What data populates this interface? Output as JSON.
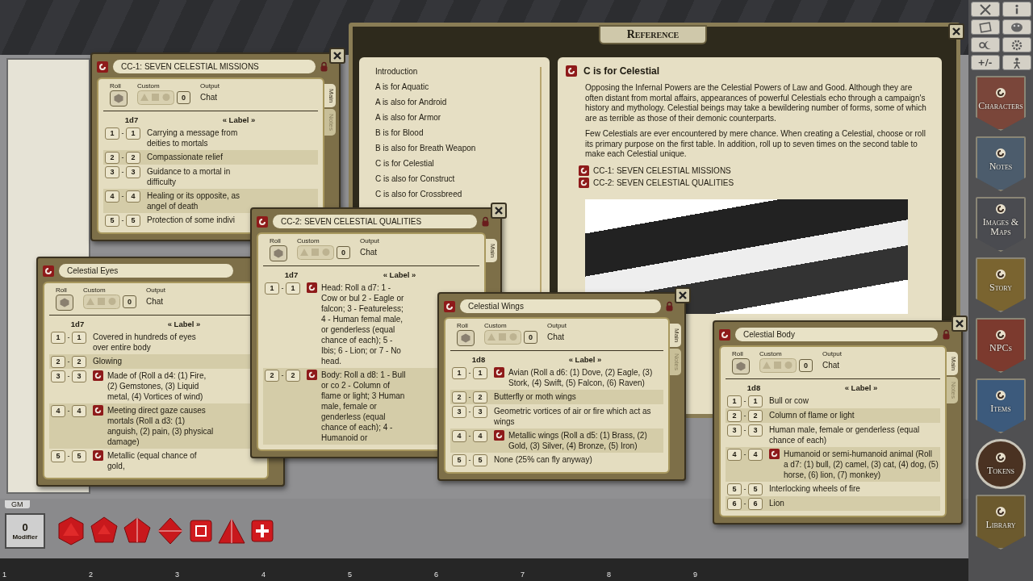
{
  "reference": {
    "title": "Reference",
    "index": [
      "Introduction",
      "A is for Aquatic",
      "A is also for Android",
      "A is also for Armor",
      "B is for Blood",
      "B is also for Breath Weapon",
      "C is for Celestial",
      "C is also for Construct",
      "C is also for Crossbreed"
    ],
    "heading": "C is for Celestial",
    "paragraphs": [
      "Opposing the Infernal Powers are the Celestial Powers of Law and Good. Although they are often distant from mortal affairs, appearances of powerful Celestials echo through a campaign's history and mythology. Celestial beings may take a bewildering number of forms, some of which are as terrible as those of their demonic counterparts.",
      "Few Celestials are ever encountered by mere chance. When creating a Celestial, choose or roll its primary purpose on the first table. In addition, roll up to seven times on the second table to make each Celestial unique."
    ],
    "links": [
      "CC-1: SEVEN CELESTIAL MISSIONS",
      "CC-2: SEVEN CELESTIAL QUALITIES"
    ]
  },
  "tables": [
    {
      "title": "CC-1: SEVEN CELESTIAL MISSIONS",
      "locked": true,
      "roll_label": "Roll",
      "custom_label": "Custom",
      "output_label": "Output",
      "custom_value": "0",
      "output": "Chat",
      "dice": "1d7",
      "label_header": "« Label »",
      "tabs": [
        {
          "label": "Main",
          "selected": true
        },
        {
          "label": "Notes",
          "selected": false
        }
      ],
      "rows": [
        {
          "from": "1",
          "dash": "-",
          "to": "1",
          "text": "Carrying a message from deities to mortals",
          "linked": false
        },
        {
          "from": "2",
          "dash": "-",
          "to": "2",
          "text": "Compassionate relief",
          "linked": false
        },
        {
          "from": "3",
          "dash": "-",
          "to": "3",
          "text": "Guidance to a mortal in difficulty",
          "linked": false
        },
        {
          "from": "4",
          "dash": "-",
          "to": "4",
          "text": "Healing or its opposite, as angel of death",
          "linked": false
        },
        {
          "from": "5",
          "dash": "-",
          "to": "5",
          "text": "Protection of some indivi",
          "linked": false
        }
      ]
    },
    {
      "title": "Celestial Eyes",
      "roll_label": "Roll",
      "custom_label": "Custom",
      "output_label": "Output",
      "custom_value": "0",
      "output": "Chat",
      "dice": "1d7",
      "label_header": "« Label »",
      "rows": [
        {
          "from": "1",
          "dash": "-",
          "to": "1",
          "text": "Covered in hundreds of eyes over entire body",
          "linked": false
        },
        {
          "from": "2",
          "dash": "-",
          "to": "2",
          "text": "Glowing",
          "linked": false
        },
        {
          "from": "3",
          "dash": "-",
          "to": "3",
          "text": "Made of (Roll a d4: (1) Fire, (2) Gemstones, (3) Liquid metal, (4) Vortices of wind)",
          "linked": true
        },
        {
          "from": "4",
          "dash": "-",
          "to": "4",
          "text": "Meeting direct gaze causes mortals (Roll a d3: (1) anguish, (2) pain, (3) physical damage)",
          "linked": true
        },
        {
          "from": "5",
          "dash": "-",
          "to": "5",
          "text": "Metallic (equal chance of gold,",
          "linked": true
        }
      ]
    },
    {
      "title": "CC-2: SEVEN CELESTIAL QUALITIES",
      "locked": true,
      "roll_label": "Roll",
      "custom_label": "Custom",
      "output_label": "Output",
      "custom_value": "0",
      "output": "Chat",
      "dice": "1d7",
      "label_header": "« Label »",
      "tabs": [
        {
          "label": "Main",
          "selected": true
        }
      ],
      "rows": [
        {
          "from": "1",
          "dash": "-",
          "to": "1",
          "text": "Head: Roll a d7: 1 - Cow or bul 2 - Eagle or falcon; 3 - Featureless; 4 - Human femal male, or genderless (equal chance of each); 5 - Ibis; 6 - Lion; or 7 - No head.",
          "linked": true
        },
        {
          "from": "2",
          "dash": "-",
          "to": "2",
          "text": "Body: Roll a d8: 1 - Bull or co 2 - Column of flame or light; 3 Human male, female or genderless (equal chance of each); 4 - Humanoid or",
          "linked": true
        }
      ]
    },
    {
      "title": "Celestial Wings",
      "locked": true,
      "roll_label": "Roll",
      "custom_label": "Custom",
      "output_label": "Output",
      "custom_value": "0",
      "output": "Chat",
      "dice": "1d8",
      "label_header": "« Label »",
      "tabs": [
        {
          "label": "Main",
          "selected": true
        },
        {
          "label": "Notes",
          "selected": false
        }
      ],
      "rows": [
        {
          "from": "1",
          "dash": "-",
          "to": "1",
          "text": "Avian (Roll a d6: (1) Dove, (2) Eagle, (3) Stork, (4) Swift, (5) Falcon, (6) Raven)",
          "linked": true
        },
        {
          "from": "2",
          "dash": "-",
          "to": "2",
          "text": "Butterfly or moth wings",
          "linked": false
        },
        {
          "from": "3",
          "dash": "-",
          "to": "3",
          "text": "Geometric vortices of air or fire which act as wings",
          "linked": false
        },
        {
          "from": "4",
          "dash": "-",
          "to": "4",
          "text": "Metallic wings (Roll a d5: (1) Brass, (2) Gold, (3) Silver, (4) Bronze, (5) Iron)",
          "linked": true
        },
        {
          "from": "5",
          "dash": "-",
          "to": "5",
          "text": "None (25% can fly anyway)",
          "linked": false
        }
      ]
    },
    {
      "title": "Celestial Body",
      "locked": true,
      "roll_label": "Roll",
      "custom_label": "Custom",
      "output_label": "Output",
      "custom_value": "0",
      "output": "Chat",
      "dice": "1d8",
      "label_header": "« Label »",
      "tabs": [
        {
          "label": "Main",
          "selected": true
        },
        {
          "label": "Notes",
          "selected": false
        }
      ],
      "rows": [
        {
          "from": "1",
          "dash": "-",
          "to": "1",
          "text": "Bull or cow",
          "linked": false
        },
        {
          "from": "2",
          "dash": "-",
          "to": "2",
          "text": "Column of flame or light",
          "linked": false
        },
        {
          "from": "3",
          "dash": "-",
          "to": "3",
          "text": "Human male, female or genderless (equal chance of each)",
          "linked": false
        },
        {
          "from": "4",
          "dash": "-",
          "to": "4",
          "text": "Humanoid or semi-humanoid animal (Roll a d7: (1) bull, (2) camel, (3) cat, (4) dog, (5) horse, (6) lion, (7) monkey)",
          "linked": true
        },
        {
          "from": "5",
          "dash": "-",
          "to": "5",
          "text": "Interlocking wheels of fire",
          "linked": false
        },
        {
          "from": "6",
          "dash": "-",
          "to": "6",
          "text": "Lion",
          "linked": false
        }
      ]
    }
  ],
  "desktop": {
    "gm_label": "GM"
  },
  "modifier": {
    "value": "0",
    "label": "Modifier"
  },
  "hotkeys": [
    "1",
    "2",
    "3",
    "4",
    "5",
    "6",
    "7",
    "8",
    "9"
  ],
  "toolbar": {
    "modifier_button": "+/-"
  },
  "sidebar": [
    {
      "label": "Characters",
      "kind": "shield",
      "color": "#7a463a"
    },
    {
      "label": "Notes",
      "kind": "shield",
      "color": "#4c5c6c"
    },
    {
      "label": "Images & Maps",
      "kind": "shield",
      "color": "#4a4b50"
    },
    {
      "label": "Story",
      "kind": "shield",
      "color": "#7a6430"
    },
    {
      "label": "NPCs",
      "kind": "shield",
      "color": "#7c3a2e"
    },
    {
      "label": "Items",
      "kind": "shield",
      "color": "#3c5a7c"
    },
    {
      "label": "Tokens",
      "kind": "round",
      "color": "#4a3222"
    },
    {
      "label": "Library",
      "kind": "shield",
      "color": "#6c5a2e"
    }
  ]
}
